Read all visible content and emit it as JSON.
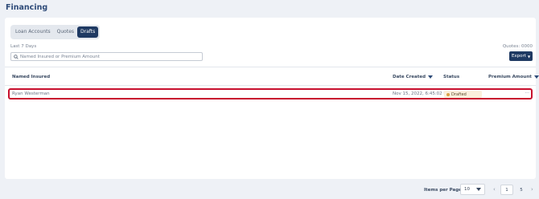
{
  "page": {
    "title": "Financing"
  },
  "tabs": [
    {
      "label": "Loan Accounts",
      "active": false
    },
    {
      "label": "Quotes",
      "active": false
    },
    {
      "label": "Drafts",
      "active": true
    }
  ],
  "filter": {
    "label": "Last 7 Days"
  },
  "search": {
    "placeholder": "Named Insured or Premium Amount",
    "value": ""
  },
  "summary": {
    "quotes_count": "Quotes: 0000"
  },
  "export": {
    "label": "Export"
  },
  "table": {
    "headers": [
      "Named Insured",
      "Date Created",
      "Status",
      "Premium Amount"
    ],
    "rows": [
      {
        "named_insured": "Ryan Westerman",
        "date_created": "Nov 15, 2022, 6:45:02 PM",
        "status": "Drafted",
        "premium_amount": "",
        "menu": "···"
      }
    ]
  },
  "pagination": {
    "items_per_page_label": "Items per Page:",
    "page_size": "10",
    "prev_icon": "‹",
    "next_icon": "›",
    "pages": [
      "1",
      "5"
    ]
  },
  "colors": {
    "accent": "#1f3a63",
    "highlight": "#c8102e",
    "draft_badge": "#fbefdc"
  }
}
